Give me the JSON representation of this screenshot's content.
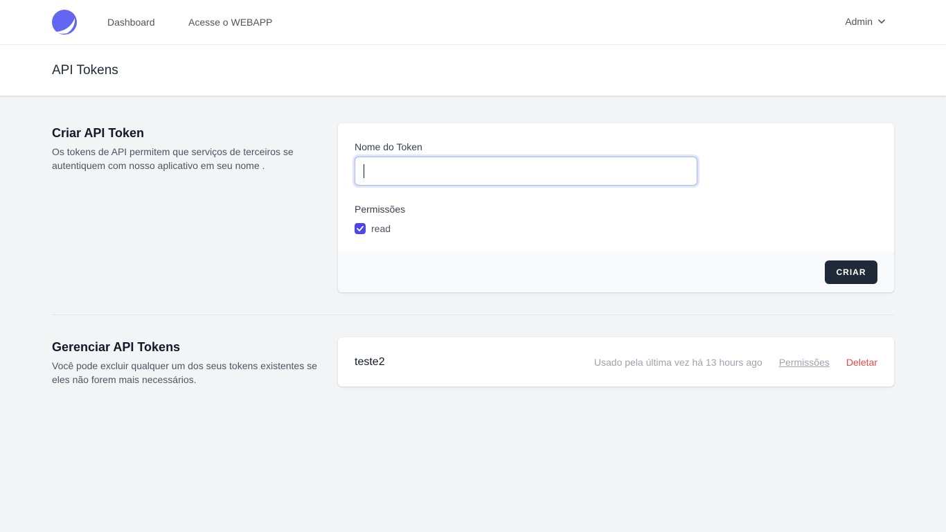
{
  "nav": {
    "links": [
      {
        "label": "Dashboard"
      },
      {
        "label": "Acesse o WEBAPP"
      }
    ],
    "user": "Admin",
    "logo_icon": "crescent-logo-icon",
    "dropdown_icon": "chevron-down-icon"
  },
  "header": {
    "title": "API Tokens"
  },
  "create": {
    "title": "Criar API Token",
    "description": "Os tokens de API permitem que serviços de terceiros se autentiquem com nosso aplicativo em seu nome .",
    "name_label": "Nome do Token",
    "name_value": "",
    "permissions_label": "Permissões",
    "permissions": [
      {
        "label": "read",
        "checked": true
      }
    ],
    "submit_label": "CRIAR"
  },
  "manage": {
    "title": "Gerenciar API Tokens",
    "description": "Você pode excluir qualquer um dos seus tokens existentes se eles não forem mais necessários.",
    "tokens": [
      {
        "name": "teste2",
        "last_used": "Usado pela última vez há 13 hours ago",
        "permissions_label": "Permissões",
        "delete_label": "Deletar"
      }
    ]
  },
  "colors": {
    "accent": "#4f46e5",
    "logo": "#6366f1",
    "button": "#1f2937",
    "danger": "#ef4444",
    "background": "#f3f4f6"
  }
}
